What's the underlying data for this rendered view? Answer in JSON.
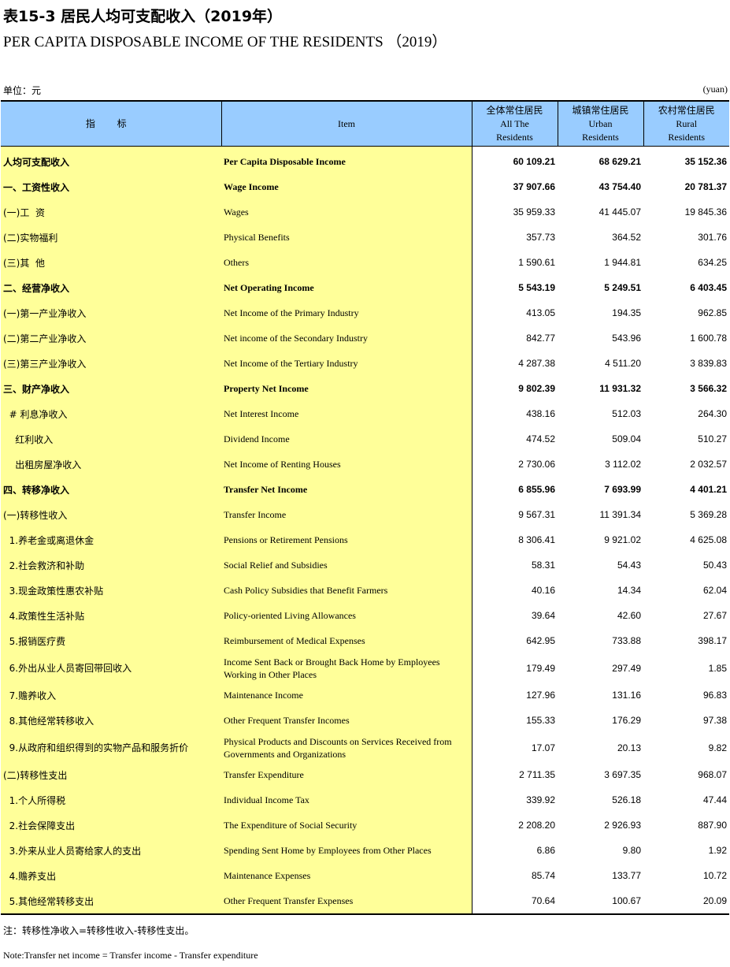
{
  "title_cn": "表15-3  居民人均可支配收入（2019年）",
  "title_en": "PER CAPITA DISPOSABLE INCOME OF THE RESIDENTS （2019）",
  "unit_cn": "单位：元",
  "unit_en": "(yuan)",
  "headers": {
    "indicator_cn": "指 标",
    "item_en": "Item",
    "col_all": [
      "全体常住居民",
      "All The",
      "Residents"
    ],
    "col_urban": [
      "城镇常住居民",
      "Urban",
      "Residents"
    ],
    "col_rural": [
      "农村常住居民",
      "Rural",
      "Residents"
    ]
  },
  "rows": [
    {
      "cn": "人均可支配收入",
      "en": "Per Capita Disposable Income",
      "all": "60 109.21",
      "urban": "68 629.21",
      "rural": "35 152.36",
      "bold": true
    },
    {
      "cn": "一、工资性收入",
      "en": "Wage Income",
      "all": "37 907.66",
      "urban": "43 754.40",
      "rural": "20 781.37",
      "bold": true
    },
    {
      "cn": "(一)工  资",
      "en": "Wages",
      "all": "35 959.33",
      "urban": "41 445.07",
      "rural": "19 845.36"
    },
    {
      "cn": "(二)实物福利",
      "en": "Physical Benefits",
      "all": "357.73",
      "urban": "364.52",
      "rural": "301.76"
    },
    {
      "cn": "(三)其  他",
      "en": "Others",
      "all": "1 590.61",
      "urban": "1 944.81",
      "rural": "634.25"
    },
    {
      "cn": "二、经营净收入",
      "en": "Net Operating Income",
      "all": "5 543.19",
      "urban": "5 249.51",
      "rural": "6 403.45",
      "bold": true
    },
    {
      "cn": "(一)第一产业净收入",
      "en": "Net Income of  the Primary Industry",
      "all": "413.05",
      "urban": "194.35",
      "rural": "962.85"
    },
    {
      "cn": "(二)第二产业净收入",
      "en": "Net income of  the Secondary Industry",
      "all": "842.77",
      "urban": "543.96",
      "rural": "1 600.78"
    },
    {
      "cn": "(三)第三产业净收入",
      "en": "Net Income of the Tertiary Industry",
      "all": "4 287.38",
      "urban": "4 511.20",
      "rural": "3 839.83"
    },
    {
      "cn": "三、财产净收入",
      "en": "Property Net Income",
      "all": "9 802.39",
      "urban": "11 931.32",
      "rural": "3 566.32",
      "bold": true
    },
    {
      "cn": "  # 利息净收入",
      "en": "Net Interest Income",
      "all": "438.16",
      "urban": "512.03",
      "rural": "264.30"
    },
    {
      "cn": "    红利收入",
      "en": "Dividend Income",
      "all": "474.52",
      "urban": "509.04",
      "rural": "510.27"
    },
    {
      "cn": "    出租房屋净收入",
      "en": "Net Income of  Renting Houses",
      "all": "2 730.06",
      "urban": "3 112.02",
      "rural": "2 032.57"
    },
    {
      "cn": "四、转移净收入",
      "en": "Transfer Net Income",
      "all": "6 855.96",
      "urban": "7 693.99",
      "rural": "4 401.21",
      "bold": true
    },
    {
      "cn": "(一)转移性收入",
      "en": "Transfer Income",
      "all": "9 567.31",
      "urban": "11 391.34",
      "rural": "5 369.28"
    },
    {
      "cn": "  1.养老金或离退休金",
      "en": " Pensions or Retirement Pensions",
      "all": "8 306.41",
      "urban": "9 921.02",
      "rural": "4 625.08"
    },
    {
      "cn": "  2.社会救济和补助",
      "en": " Social Relief and Subsidies",
      "all": "58.31",
      "urban": "54.43",
      "rural": "50.43"
    },
    {
      "cn": "  3.现金政策性惠农补贴",
      "en": "Cash Policy Subsidies that Benefit Farmers",
      "all": "40.16",
      "urban": "14.34",
      "rural": "62.04"
    },
    {
      "cn": "  4.政策性生活补贴",
      "en": "Policy-oriented Living Allowances",
      "all": "39.64",
      "urban": "42.60",
      "rural": "27.67"
    },
    {
      "cn": "  5.报销医疗费",
      "en": "Reimbursement of Medical Expenses",
      "all": "642.95",
      "urban": "733.88",
      "rural": "398.17"
    },
    {
      "cn": "  6.外出从业人员寄回带回收入",
      "en": "Income Sent Back or Brought Back Home by Employees Working in Other Places",
      "all": "179.49",
      "urban": "297.49",
      "rural": "1.85",
      "tall": true
    },
    {
      "cn": "  7.赡养收入",
      "en": "Maintenance Income",
      "all": "127.96",
      "urban": "131.16",
      "rural": "96.83"
    },
    {
      "cn": "  8.其他经常转移收入",
      "en": "Other Frequent Transfer Incomes",
      "all": "155.33",
      "urban": "176.29",
      "rural": "97.38"
    },
    {
      "cn": "  9.从政府和组织得到的实物产品和服务折价",
      "en": "Physical Products and Discounts on Services Received from Governments and Organizations",
      "all": "17.07",
      "urban": "20.13",
      "rural": "9.82",
      "tall": true
    },
    {
      "cn": "(二)转移性支出",
      "en": "Transfer Expenditure",
      "all": "2 711.35",
      "urban": "3 697.35",
      "rural": "968.07"
    },
    {
      "cn": "  1.个人所得税",
      "en": "Individual Income Tax",
      "all": "339.92",
      "urban": "526.18",
      "rural": "47.44"
    },
    {
      "cn": "  2.社会保障支出",
      "en": "The Expenditure of Social Security",
      "all": "2 208.20",
      "urban": "2 926.93",
      "rural": "887.90"
    },
    {
      "cn": "  3.外来从业人员寄给家人的支出",
      "en": "Spending Sent Home by Employees from Other Places",
      "all": "6.86",
      "urban": "9.80",
      "rural": "1.92"
    },
    {
      "cn": "  4.赡养支出",
      "en": "Maintenance Expenses",
      "all": "85.74",
      "urban": "133.77",
      "rural": "10.72"
    },
    {
      "cn": "  5.其他经常转移支出",
      "en": "Other Frequent Transfer Expenses",
      "all": "70.64",
      "urban": "100.67",
      "rural": "20.09"
    }
  ],
  "note_cn": "注：转移性净收入=转移性收入-转移性支出。",
  "note_en": "Note:Transfer net income = Transfer income - Transfer expenditure",
  "colors": {
    "header_bg": "#99ccff",
    "label_bg": "#ffff99"
  }
}
